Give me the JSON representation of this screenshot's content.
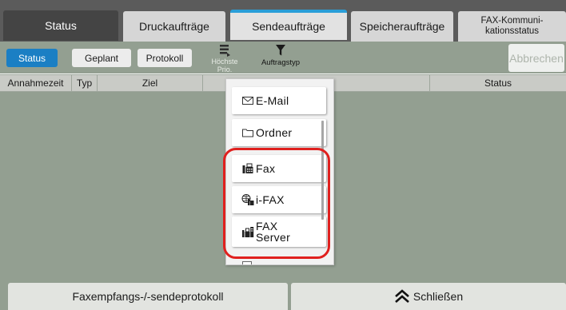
{
  "main_tabs": [
    {
      "label": "Status"
    },
    {
      "label": "Druckaufträge"
    },
    {
      "label": "Sendeaufträge"
    },
    {
      "label": "Speicheraufträge"
    },
    {
      "label": "FAX-Kommuni-\nkationsstatus"
    }
  ],
  "sub_tabs": {
    "status": "Status",
    "scheduled": "Geplant",
    "log": "Protokoll",
    "priority_label": "Höchste Prio.",
    "job_type_label": "Auftragstyp",
    "cancel": "Abbrechen"
  },
  "table": {
    "columns": [
      "Annahmezeit",
      "Typ",
      "Ziel",
      "Status"
    ]
  },
  "dropdown": {
    "items": [
      {
        "label": "E-Mail",
        "icon": "email-icon"
      },
      {
        "label": "Ordner",
        "icon": "folder-icon"
      },
      {
        "label": "Fax",
        "icon": "fax-icon"
      },
      {
        "label": "i-FAX",
        "icon": "ifax-icon"
      },
      {
        "label": "FAX\nServer",
        "icon": "fax-server-icon"
      }
    ]
  },
  "bottom": {
    "log_button": "Faxempfangs-/-sendeprotokoll",
    "close_button": "Schließen"
  },
  "colors": {
    "accent_blue": "#1b7fc4",
    "highlight_red": "#e0201e",
    "panel_gray_green": "#939f91"
  }
}
